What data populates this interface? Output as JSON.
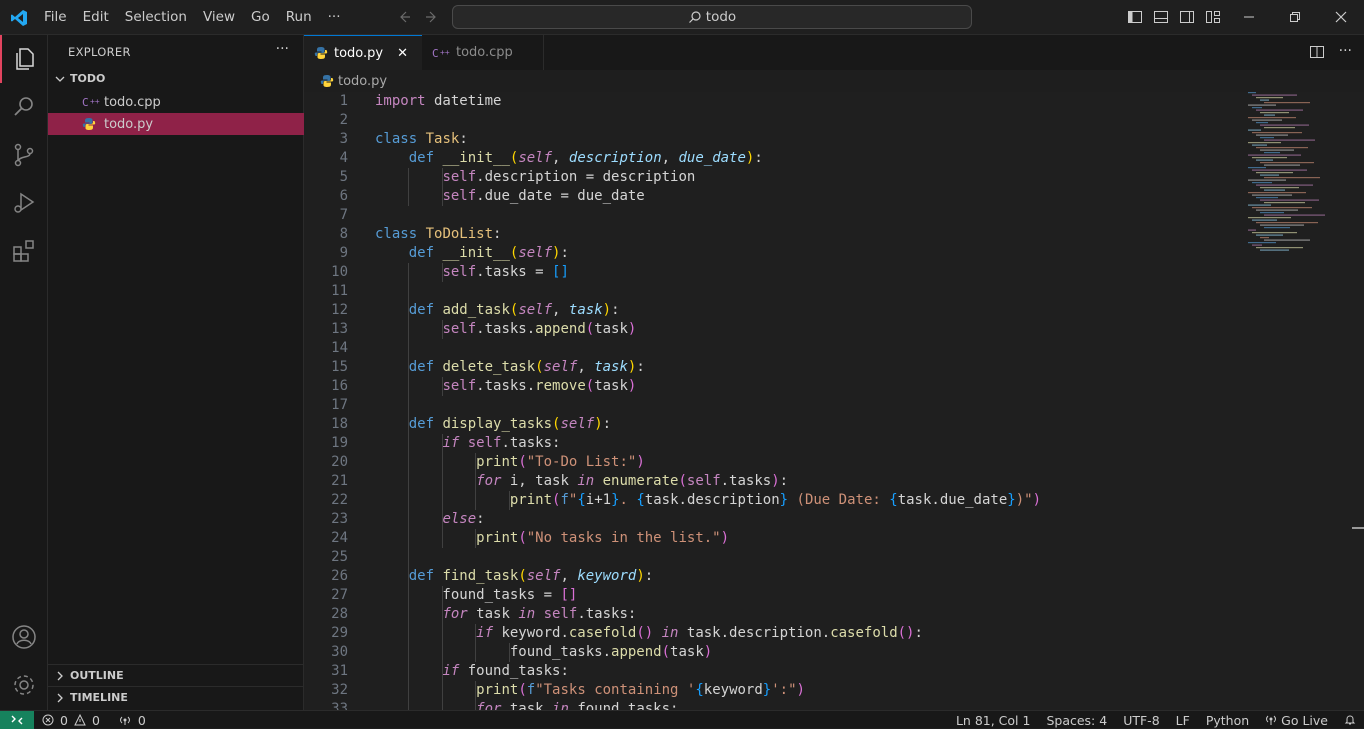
{
  "menu": [
    "File",
    "Edit",
    "Selection",
    "View",
    "Go",
    "Run",
    "···"
  ],
  "search": {
    "text": "todo"
  },
  "explorer": {
    "title": "EXPLORER",
    "folder": "TODO",
    "files": [
      "todo.cpp",
      "todo.py"
    ],
    "outline": "OUTLINE",
    "timeline": "TIMELINE"
  },
  "tabs": [
    {
      "label": "todo.py",
      "active": true
    },
    {
      "label": "todo.cpp",
      "active": false
    }
  ],
  "breadcrumb": "todo.py",
  "code": [
    {
      "n": "1",
      "h": "<span class='k'>import</span> datetime",
      "g": 0
    },
    {
      "n": "2",
      "h": "",
      "g": 0
    },
    {
      "n": "3",
      "h": "<span class='kd'>class</span> <span class='cls'>Task</span>:",
      "g": 0
    },
    {
      "n": "4",
      "h": "    <span class='kd'>def</span> <span class='fn'>__init__</span><span class='b1'>(</span><span class='sf'>self</span>, <span class='pr'>description</span>, <span class='pr'>due_date</span><span class='b1'>)</span>:",
      "g": 0
    },
    {
      "n": "5",
      "h": "        <span class='sf' style='font-style:normal'>self</span>.description = description",
      "g": 2
    },
    {
      "n": "6",
      "h": "        <span class='sf' style='font-style:normal'>self</span>.due_date = due_date",
      "g": 2
    },
    {
      "n": "7",
      "h": "",
      "g": 0
    },
    {
      "n": "8",
      "h": "<span class='kd'>class</span> <span class='cls'>ToDoList</span>:",
      "g": 0
    },
    {
      "n": "9",
      "h": "    <span class='kd'>def</span> <span class='fn'>__init__</span><span class='b1'>(</span><span class='sf'>self</span><span class='b1'>)</span>:",
      "g": 0
    },
    {
      "n": "10",
      "h": "        <span class='sf' style='font-style:normal'>self</span>.tasks = <span class='b3'>[]</span>",
      "g": 2
    },
    {
      "n": "11",
      "h": "",
      "g": 1
    },
    {
      "n": "12",
      "h": "    <span class='kd'>def</span> <span class='fn'>add_task</span><span class='b1'>(</span><span class='sf'>self</span>, <span class='pr'>task</span><span class='b1'>)</span>:",
      "g": 1
    },
    {
      "n": "13",
      "h": "        <span class='sf' style='font-style:normal'>self</span>.tasks.<span class='fn'>append</span><span class='b2'>(</span>task<span class='b2'>)</span>",
      "g": 2
    },
    {
      "n": "14",
      "h": "",
      "g": 1
    },
    {
      "n": "15",
      "h": "    <span class='kd'>def</span> <span class='fn'>delete_task</span><span class='b1'>(</span><span class='sf'>self</span>, <span class='pr'>task</span><span class='b1'>)</span>:",
      "g": 1
    },
    {
      "n": "16",
      "h": "        <span class='sf' style='font-style:normal'>self</span>.tasks.<span class='fn'>remove</span><span class='b2'>(</span>task<span class='b2'>)</span>",
      "g": 2
    },
    {
      "n": "17",
      "h": "",
      "g": 1
    },
    {
      "n": "18",
      "h": "    <span class='kd'>def</span> <span class='fn'>display_tasks</span><span class='b1'>(</span><span class='sf'>self</span><span class='b1'>)</span>:",
      "g": 1
    },
    {
      "n": "19",
      "h": "        <span class='kw'>if</span> <span class='sf' style='font-style:normal'>self</span>.tasks:",
      "g": 2
    },
    {
      "n": "20",
      "h": "            <span class='fn'>print</span><span class='b2'>(</span><span class='st'>\"To-Do List:\"</span><span class='b2'>)</span>",
      "g": 3
    },
    {
      "n": "21",
      "h": "            <span class='kw'>for</span> i, task <span class='kw'>in</span> <span class='fn'>enumerate</span><span class='b2'>(</span><span class='sf' style='font-style:normal'>self</span>.tasks<span class='b2'>)</span>:",
      "g": 3
    },
    {
      "n": "22",
      "h": "                <span class='fn'>print</span><span class='b2'>(</span><span class='kd'>f</span><span class='st'>\"</span><span class='b3'>{</span>i+1<span class='b3'>}</span><span class='st'>. </span><span class='b3'>{</span>task.description<span class='b3'>}</span><span class='st'> (Due Date: </span><span class='b3'>{</span>task.due_date<span class='b3'>}</span><span class='st'>)\"</span><span class='b2'>)</span>",
      "g": 4
    },
    {
      "n": "23",
      "h": "        <span class='kw'>else</span>:",
      "g": 2
    },
    {
      "n": "24",
      "h": "            <span class='fn'>print</span><span class='b2'>(</span><span class='st'>\"No tasks in the list.\"</span><span class='b2'>)</span>",
      "g": 3
    },
    {
      "n": "25",
      "h": "",
      "g": 1
    },
    {
      "n": "26",
      "h": "    <span class='kd'>def</span> <span class='fn'>find_task</span><span class='b1'>(</span><span class='sf'>self</span>, <span class='pr'>keyword</span><span class='b1'>)</span>:",
      "g": 1
    },
    {
      "n": "27",
      "h": "        found_tasks = <span class='b2'>[]</span>",
      "g": 2
    },
    {
      "n": "28",
      "h": "        <span class='kw'>for</span> task <span class='kw'>in</span> <span class='sf' style='font-style:normal'>self</span>.tasks:",
      "g": 2
    },
    {
      "n": "29",
      "h": "            <span class='kw'>if</span> keyword.<span class='fn'>casefold</span><span class='b2'>()</span> <span class='kw'>in</span> task.description.<span class='fn'>casefold</span><span class='b2'>()</span>:",
      "g": 3
    },
    {
      "n": "30",
      "h": "                found_tasks.<span class='fn'>append</span><span class='b2'>(</span>task<span class='b2'>)</span>",
      "g": 4
    },
    {
      "n": "31",
      "h": "        <span class='kw'>if</span> found_tasks:",
      "g": 2
    },
    {
      "n": "32",
      "h": "            <span class='fn'>print</span><span class='b2'>(</span><span class='kd'>f</span><span class='st'>\"Tasks containing '</span><span class='b3'>{</span>keyword<span class='b3'>}</span><span class='st'>':\"</span><span class='b2'>)</span>",
      "g": 3
    },
    {
      "n": "33",
      "h": "            <span class='kw'>for</span> task <span class='kw'>in</span> found_tasks:",
      "g": 3
    }
  ],
  "status": {
    "errors": "0",
    "warnings": "0",
    "ports": "0",
    "position": "Ln 81, Col 1",
    "spaces": "Spaces: 4",
    "encoding": "UTF-8",
    "eol": "LF",
    "language": "Python",
    "golive": "Go Live"
  },
  "colors": {
    "accent": "#0078d4",
    "selection": "#8f2248",
    "remote": "#16825d",
    "activeIndicator": "#e2445f"
  }
}
